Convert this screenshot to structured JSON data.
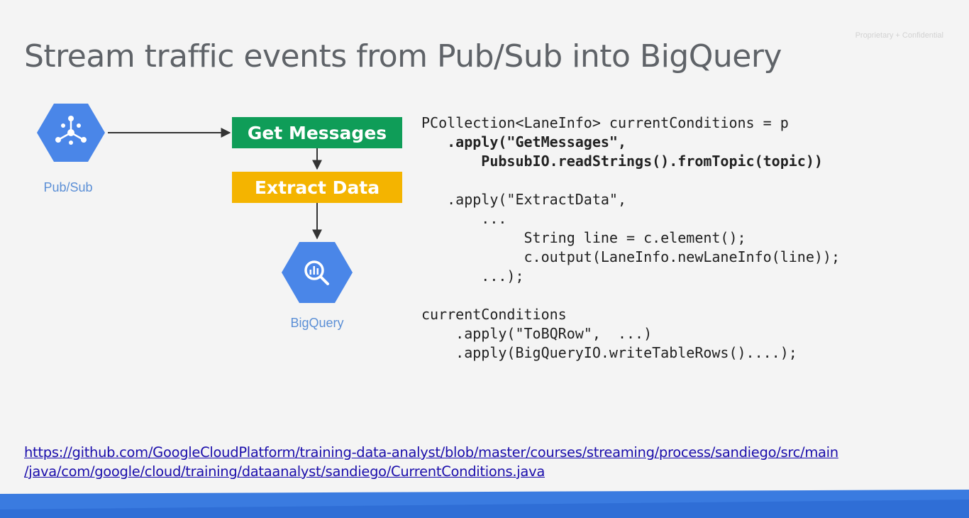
{
  "header": {
    "confidential": "Proprietary + Confidential",
    "title": "Stream traffic events from Pub/Sub into BigQuery"
  },
  "diagram": {
    "pubsub_label": "Pub/Sub",
    "get_messages_label": "Get Messages",
    "extract_data_label": "Extract Data",
    "bigquery_label": "BigQuery",
    "colors": {
      "hexagon": "#4a86e8",
      "get_messages": "#0f9d58",
      "extract_data": "#f4b400",
      "label": "#5b8fd6"
    }
  },
  "code": {
    "lines": [
      {
        "text": "PCollection<LaneInfo> currentConditions = p",
        "bold": false
      },
      {
        "text": "   .apply(\"GetMessages\",",
        "bold": true
      },
      {
        "text": "       PubsubIO.readStrings().fromTopic(topic))",
        "bold": true
      },
      {
        "text": "",
        "bold": false
      },
      {
        "text": "   .apply(\"ExtractData\",",
        "bold": false
      },
      {
        "text": "       ...",
        "bold": false
      },
      {
        "text": "            String line = c.element();",
        "bold": false
      },
      {
        "text": "            c.output(LaneInfo.newLaneInfo(line));",
        "bold": false
      },
      {
        "text": "       ...);",
        "bold": false
      },
      {
        "text": "",
        "bold": false
      },
      {
        "text": "currentConditions",
        "bold": false
      },
      {
        "text": "    .apply(\"ToBQRow\",  ...)",
        "bold": false
      },
      {
        "text": "    .apply(BigQueryIO.writeTableRows()....);",
        "bold": false
      }
    ]
  },
  "link": {
    "line1": "https://github.com/GoogleCloudPlatform/training-data-analyst/blob/master/courses/streaming/process/sandiego/src/main",
    "line2": "/java/com/google/cloud/training/dataanalyst/sandiego/CurrentConditions.java"
  }
}
